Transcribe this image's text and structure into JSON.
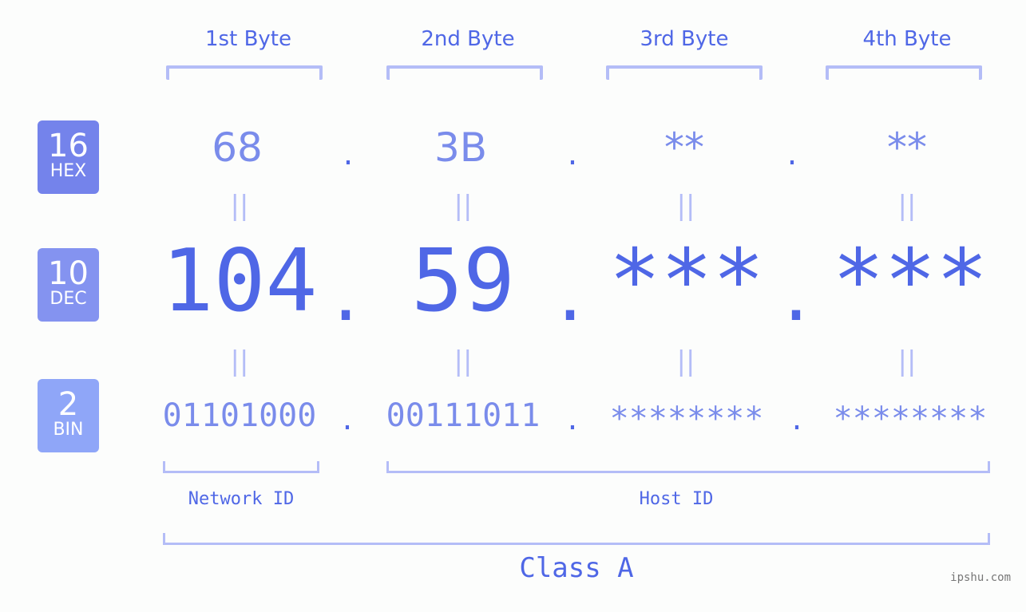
{
  "headers": [
    "1st Byte",
    "2nd Byte",
    "3rd Byte",
    "4th Byte"
  ],
  "badges": {
    "hex": {
      "num": "16",
      "label": "HEX",
      "color": "#7483eb"
    },
    "dec": {
      "num": "10",
      "label": "DEC",
      "color": "#8493f0"
    },
    "bin": {
      "num": "2",
      "label": "BIN",
      "color": "#8fa6f8"
    }
  },
  "hex": [
    "68",
    "3B",
    "**",
    "**"
  ],
  "dec": [
    "104",
    "59",
    "***",
    "***"
  ],
  "bin": [
    "01101000",
    "00111011",
    "********",
    "********"
  ],
  "separator": ".",
  "equals": "=",
  "network_id_label": "Network ID",
  "host_id_label": "Host ID",
  "class_label": "Class A",
  "watermark": "ipshu.com"
}
